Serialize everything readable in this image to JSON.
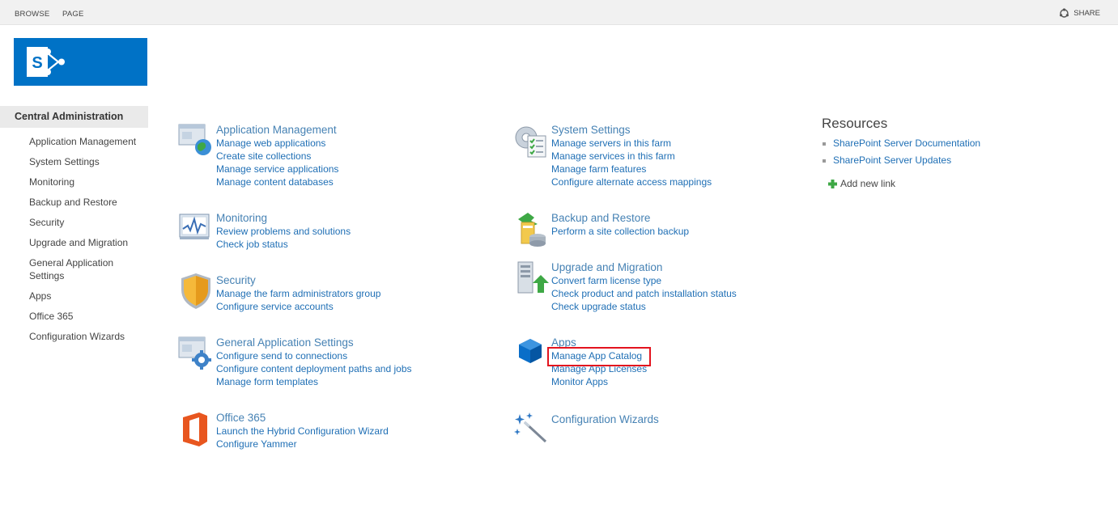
{
  "ribbon": {
    "tabs": [
      "BROWSE",
      "PAGE"
    ],
    "share_label": "SHARE"
  },
  "logo": {
    "letter": "S",
    "brand_color": "#0072c6"
  },
  "left_nav": {
    "header": "Central Administration",
    "items": [
      "Application Management",
      "System Settings",
      "Monitoring",
      "Backup and Restore",
      "Security",
      "Upgrade and Migration",
      "General Application Settings",
      "Apps",
      "Office 365",
      "Configuration Wizards"
    ]
  },
  "sections": {
    "application_management": {
      "title": "Application Management",
      "icon": "application-management-icon",
      "links": [
        "Manage web applications",
        "Create site collections",
        "Manage service applications",
        "Manage content databases"
      ]
    },
    "monitoring": {
      "title": "Monitoring",
      "icon": "monitoring-icon",
      "links": [
        "Review problems and solutions",
        "Check job status"
      ]
    },
    "security": {
      "title": "Security",
      "icon": "shield-icon",
      "links": [
        "Manage the farm administrators group",
        "Configure service accounts"
      ]
    },
    "general_application_settings": {
      "title": "General Application Settings",
      "icon": "general-settings-icon",
      "links": [
        "Configure send to connections",
        "Configure content deployment paths and jobs",
        "Manage form templates"
      ]
    },
    "office365": {
      "title": "Office 365",
      "icon": "office365-icon",
      "links": [
        "Launch the Hybrid Configuration Wizard",
        "Configure Yammer"
      ]
    },
    "system_settings": {
      "title": "System Settings",
      "icon": "system-settings-icon",
      "links": [
        "Manage servers in this farm",
        "Manage services in this farm",
        "Manage farm features",
        "Configure alternate access mappings"
      ]
    },
    "backup_restore": {
      "title": "Backup and Restore",
      "icon": "backup-restore-icon",
      "links": [
        "Perform a site collection backup"
      ]
    },
    "upgrade_migration": {
      "title": "Upgrade and Migration",
      "icon": "upgrade-migration-icon",
      "links": [
        "Convert farm license type",
        "Check product and patch installation status",
        "Check upgrade status"
      ]
    },
    "apps": {
      "title": "Apps",
      "icon": "apps-cube-icon",
      "links": [
        "Manage App Catalog",
        "Manage App Licenses",
        "Monitor Apps"
      ]
    },
    "configuration_wizards": {
      "title": "Configuration Wizards",
      "icon": "wizard-wand-icon",
      "links": []
    }
  },
  "resources": {
    "title": "Resources",
    "items": [
      "SharePoint Server Documentation",
      "SharePoint Server Updates"
    ],
    "add_link": "Add new link"
  },
  "colors": {
    "link": "#1f6fb5",
    "section_title": "#4682b4",
    "highlight": "#e3141e"
  }
}
